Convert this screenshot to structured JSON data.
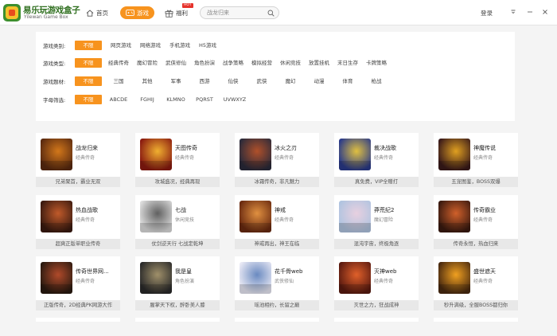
{
  "header": {
    "logo_title": "易乐玩游戏盒子",
    "logo_subtitle": "Yilewan Game Box",
    "nav_home": "首页",
    "nav_game": "游戏",
    "nav_welfare": "福利",
    "hot_badge": "HOT",
    "search_placeholder": "战龙归来",
    "login": "登录"
  },
  "filters": {
    "rows": [
      {
        "label": "游戏类别:",
        "options": [
          "不限",
          "网页游戏",
          "网络游戏",
          "手机游戏",
          "H5游戏"
        ],
        "active": 0
      },
      {
        "label": "游戏类型:",
        "options": [
          "不限",
          "经典传奇",
          "魔幻冒险",
          "武侠修仙",
          "角色扮演",
          "战争策略",
          "模拟经营",
          "休闲竞技",
          "放置挂机",
          "末日生存",
          "卡牌策略"
        ],
        "active": 0
      },
      {
        "label": "游戏题材:",
        "options": [
          "不限",
          "三国",
          "其他",
          "军事",
          "西游",
          "仙侠",
          "武侠",
          "魔幻",
          "动漫",
          "体育",
          "枪战"
        ],
        "active": 0
      },
      {
        "label": "字母筛选:",
        "options": [
          "不限",
          "ABCDE",
          "FGHIJ",
          "KLMNO",
          "PQRST",
          "UVWXYZ"
        ],
        "active": 0
      }
    ]
  },
  "games": [
    {
      "name": "战龙归来",
      "category": "经典传奇",
      "desc": "兄弟聚首，霸业无双",
      "color1": "#5a2a10",
      "color2": "#d2771a"
    },
    {
      "name": "天图传奇",
      "category": "经典传奇",
      "desc": "攻城盛况，经典再现",
      "color1": "#8a1a10",
      "color2": "#f0b030"
    },
    {
      "name": "冰火之刃",
      "category": "经典传奇",
      "desc": "冰霜传奇，非凡魅力",
      "color1": "#2a2a3a",
      "color2": "#b0502a"
    },
    {
      "name": "裁决战歌",
      "category": "经典传奇",
      "desc": "真免费，VIP全赠打",
      "color1": "#2a3a8a",
      "color2": "#e0c040"
    },
    {
      "name": "神魔传说",
      "category": "经典传奇",
      "desc": "五宠图鉴，BOSS双爆",
      "color1": "#3a1a1a",
      "color2": "#e0a020"
    },
    {
      "name": "热血战歌",
      "category": "经典传奇",
      "desc": "超爽正版单职业传奇",
      "color1": "#3a1a10",
      "color2": "#c05a2a"
    },
    {
      "name": "七战",
      "category": "休闲竞技",
      "desc": "仗剑逆天行 七战定乾坤",
      "color1": "#dcdcdc",
      "color2": "#606060"
    },
    {
      "name": "神戒",
      "category": "经典传奇",
      "desc": "神戒再出，神王在临",
      "color1": "#6a2a10",
      "color2": "#e09040"
    },
    {
      "name": "莽荒纪2",
      "category": "魔幻冒险",
      "desc": "混沌宇宙，终极角逐",
      "color1": "#b0c4e0",
      "color2": "#e8d0e0"
    },
    {
      "name": "传奇霸业",
      "category": "经典传奇",
      "desc": "传奇永恒，热血归来",
      "color1": "#3a1a10",
      "color2": "#d0602a"
    },
    {
      "name": "传奇世界网...",
      "category": "经典传奇",
      "desc": "正版传奇，2D经典PK网游大作",
      "color1": "#2a1a10",
      "color2": "#b04a2a"
    },
    {
      "name": "我是皇",
      "category": "角色扮演",
      "desc": "腥掌天下权，醉卧美人膝",
      "color1": "#2a2a2a",
      "color2": "#a0906a"
    },
    {
      "name": "花千骨web",
      "category": "武侠修仙",
      "desc": "瑶池相约，长留之巅",
      "color1": "#e8e8f4",
      "color2": "#6a8ac0"
    },
    {
      "name": "灭神web",
      "category": "经典传奇",
      "desc": "灭世之力，狂战成神",
      "color1": "#5a1a10",
      "color2": "#e0602a"
    },
    {
      "name": "盛世遮天",
      "category": "经典传奇",
      "desc": "秒升满级，全服BOSS都归你",
      "color1": "#4a2a10",
      "color2": "#f0a020"
    }
  ]
}
